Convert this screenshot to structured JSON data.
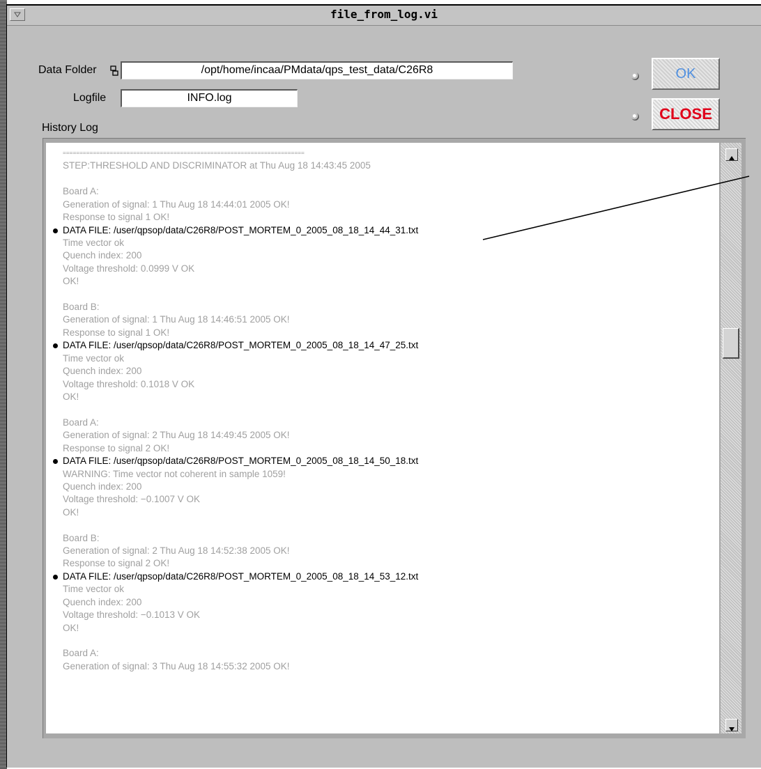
{
  "window": {
    "title": "file_from_log.vi"
  },
  "form": {
    "data_folder_label": "Data Folder",
    "data_folder_value": "/opt/home/incaa/PMdata/qps_test_data/C26R8",
    "logfile_label": "Logfile",
    "logfile_value": "INFO.log",
    "history_label": "History Log"
  },
  "buttons": {
    "ok_label": "OK",
    "close_label": "CLOSE"
  },
  "colors": {
    "window_bg": "#bebebe",
    "ok_text": "#4f8fe0",
    "close_text": "#e0001a",
    "log_dim_text": "#a0a0a0",
    "log_data_file_text": "#000000"
  },
  "icons": {
    "window_menu": "triangle-down-icon",
    "folder_browse": "folder-browse-icon",
    "scroll_up": "triangle-up-icon",
    "scroll_down": "triangle-down-icon"
  },
  "log": {
    "lines": [
      {
        "text": "========================================================================",
        "kind": "sep"
      },
      {
        "text": "STEP:THRESHOLD AND DISCRIMINATOR at Thu Aug 18 14:43:45 2005",
        "kind": "normal"
      },
      {
        "text": "",
        "kind": "blank"
      },
      {
        "text": "Board A:",
        "kind": "normal"
      },
      {
        "text": "Generation of signal: 1 Thu Aug 18 14:44:01 2005  OK!",
        "kind": "normal"
      },
      {
        "text": "Response to signal 1      OK!",
        "kind": "normal"
      },
      {
        "text": "DATA FILE: /user/qpsop/data/C26R8/POST_MORTEM_0_2005_08_18_14_44_31.txt",
        "kind": "datafile"
      },
      {
        "text": "Time vector ok",
        "kind": "normal"
      },
      {
        "text": "Quench index: 200",
        "kind": "normal"
      },
      {
        "text": "Voltage threshold: 0.0999 V      OK",
        "kind": "normal"
      },
      {
        "text": "  OK!",
        "kind": "normal"
      },
      {
        "text": "",
        "kind": "blank"
      },
      {
        "text": "Board B:",
        "kind": "normal"
      },
      {
        "text": "Generation of signal: 1 Thu Aug 18 14:46:51 2005  OK!",
        "kind": "normal"
      },
      {
        "text": "Response to signal 1      OK!",
        "kind": "normal"
      },
      {
        "text": "DATA FILE: /user/qpsop/data/C26R8/POST_MORTEM_0_2005_08_18_14_47_25.txt",
        "kind": "datafile"
      },
      {
        "text": "Time vector ok",
        "kind": "normal"
      },
      {
        "text": "Quench index: 200",
        "kind": "normal"
      },
      {
        "text": "Voltage threshold: 0.1018 V      OK",
        "kind": "normal"
      },
      {
        "text": "  OK!",
        "kind": "normal"
      },
      {
        "text": "",
        "kind": "blank"
      },
      {
        "text": "Board A:",
        "kind": "normal"
      },
      {
        "text": "Generation of signal: 2 Thu Aug 18 14:49:45 2005  OK!",
        "kind": "normal"
      },
      {
        "text": "Response to signal 2      OK!",
        "kind": "normal"
      },
      {
        "text": "DATA FILE: /user/qpsop/data/C26R8/POST_MORTEM_0_2005_08_18_14_50_18.txt",
        "kind": "datafile"
      },
      {
        "text": "WARNING: Time vector not coherent in sample 1059!",
        "kind": "normal"
      },
      {
        "text": "Quench index: 200",
        "kind": "normal"
      },
      {
        "text": "Voltage threshold: −0.1007 V      OK",
        "kind": "normal"
      },
      {
        "text": "  OK!",
        "kind": "normal"
      },
      {
        "text": "",
        "kind": "blank"
      },
      {
        "text": "Board B:",
        "kind": "normal"
      },
      {
        "text": "Generation of signal: 2 Thu Aug 18 14:52:38 2005  OK!",
        "kind": "normal"
      },
      {
        "text": "Response to signal 2      OK!",
        "kind": "normal"
      },
      {
        "text": "DATA FILE: /user/qpsop/data/C26R8/POST_MORTEM_0_2005_08_18_14_53_12.txt",
        "kind": "datafile"
      },
      {
        "text": "Time vector ok",
        "kind": "normal"
      },
      {
        "text": "Quench index: 200",
        "kind": "normal"
      },
      {
        "text": "Voltage threshold: −0.1013 V      OK",
        "kind": "normal"
      },
      {
        "text": "  OK!",
        "kind": "normal"
      },
      {
        "text": "",
        "kind": "blank"
      },
      {
        "text": "Board A:",
        "kind": "normal"
      },
      {
        "text": "Generation of signal: 3 Thu Aug 18 14:55:32 2005  OK!",
        "kind": "normal"
      }
    ]
  }
}
